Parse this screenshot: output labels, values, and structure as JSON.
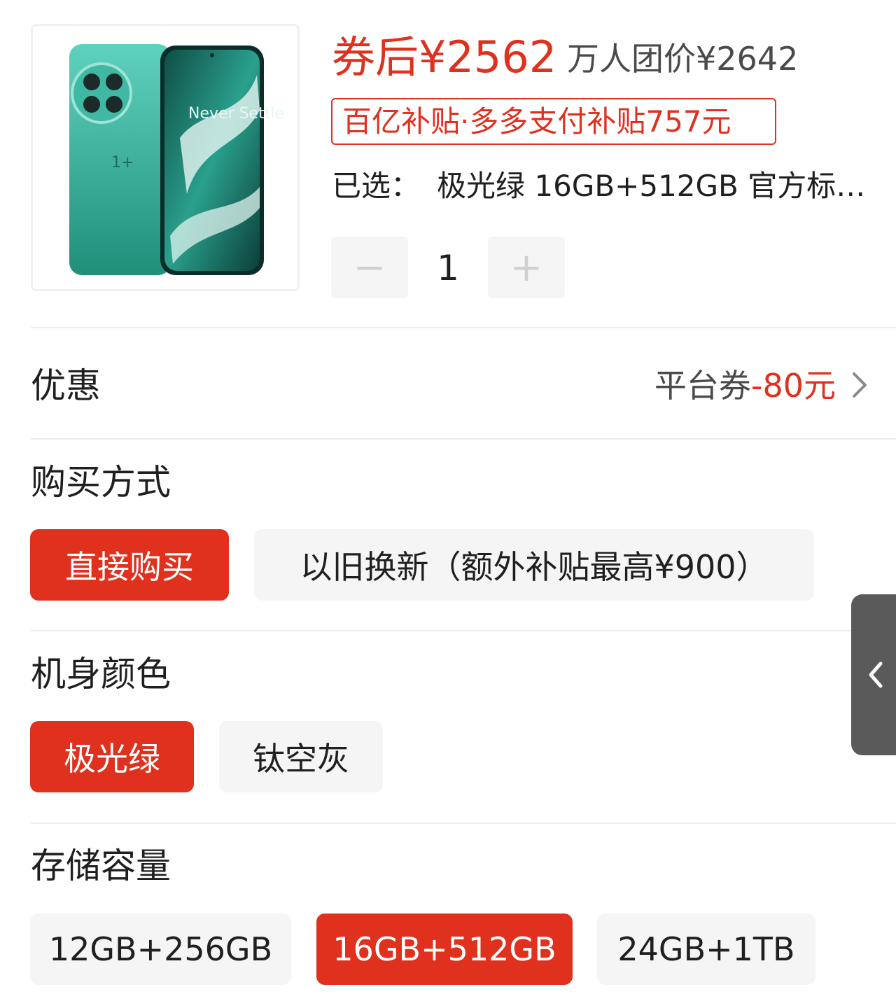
{
  "product": {
    "image_alt": "phone-product-image",
    "image_text": "Never Settle"
  },
  "price": {
    "after_coupon": "券后¥2562",
    "group_price": "万人团价¥2642"
  },
  "subsidy_badge": "百亿补贴·多多支付补贴757元",
  "selected": {
    "label": "已选：",
    "value": "极光绿 16GB+512GB 官方标…"
  },
  "quantity": {
    "minus": "−",
    "value": "1",
    "plus": "+"
  },
  "discount": {
    "label": "优惠",
    "value_prefix": "平台券",
    "value_amount": "-80元"
  },
  "purchase_method": {
    "title": "购买方式",
    "options": [
      "直接购买",
      "以旧换新（额外补贴最高¥900）"
    ],
    "selected_index": 0
  },
  "color": {
    "title": "机身颜色",
    "options": [
      "极光绿",
      "钛空灰"
    ],
    "selected_index": 0
  },
  "storage": {
    "title": "存储容量",
    "options": [
      "12GB+256GB",
      "16GB+512GB",
      "24GB+1TB"
    ],
    "selected_index": 1
  },
  "theme": {
    "accent": "#e0301e",
    "chip_bg": "#f5f5f5",
    "side_tab_bg": "#5a5a5a",
    "phone_green": "#2fae94"
  },
  "icons": {
    "chevron_right": "chevron-right-icon",
    "side_tab": "chevron-left-icon"
  }
}
